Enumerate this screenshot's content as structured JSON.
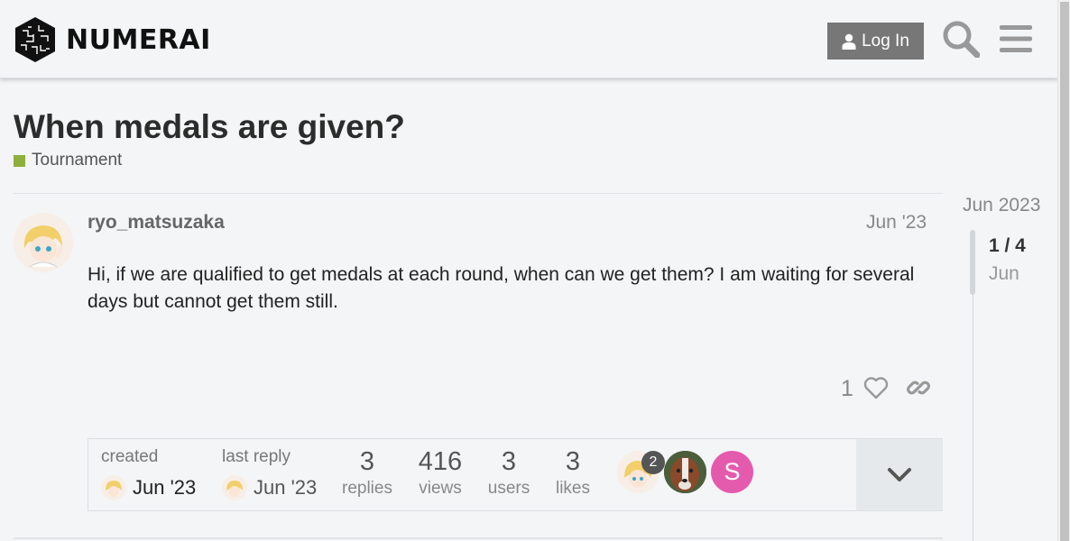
{
  "header": {
    "logo_text": "NUMERAI",
    "login_label": "Log In"
  },
  "topic": {
    "title": "When medals are given?",
    "category": "Tournament",
    "category_color": "#8daf3b"
  },
  "post": {
    "username": "ryo_matsuzaka",
    "date": "Jun '23",
    "body": "Hi, if we are qualified to get medals at each round, when can we get them? I am waiting for several days but cannot get them still.",
    "likes": "1"
  },
  "topic_map": {
    "created_label": "created",
    "created_date": "Jun '23",
    "last_reply_label": "last reply",
    "last_reply_date": "Jun '23",
    "stats": [
      {
        "num": "3",
        "label": "replies"
      },
      {
        "num": "416",
        "label": "views"
      },
      {
        "num": "3",
        "label": "users"
      },
      {
        "num": "3",
        "label": "likes"
      }
    ],
    "participant_badge": "2",
    "participant_letter": "S"
  },
  "timeline": {
    "top_date": "Jun 2023",
    "count": "1 / 4",
    "date": "Jun"
  }
}
